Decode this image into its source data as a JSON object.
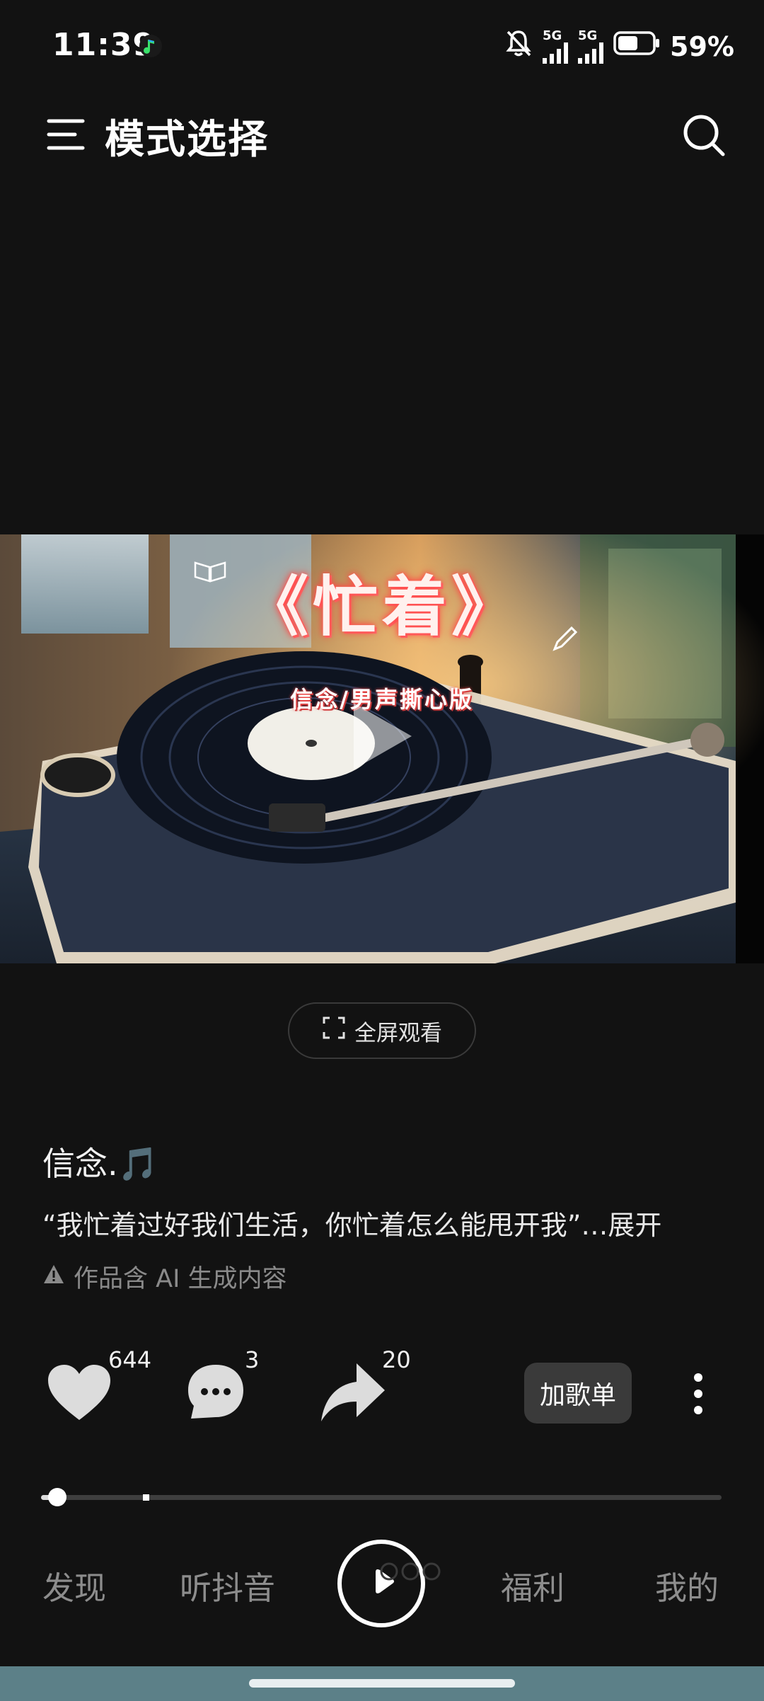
{
  "status_bar": {
    "time": "11:39",
    "signal1_label": "5G",
    "signal2_label": "5G",
    "battery_percent": "59%",
    "battery_level": 0.59
  },
  "header": {
    "title": "模式选择"
  },
  "video": {
    "overlay_title": "《忙着》",
    "overlay_subtitle": "信念/男声撕心版"
  },
  "fullscreen": {
    "label": "全屏观看"
  },
  "song": {
    "title": "信念.🎵",
    "lyric": "“我忙着过好我们生活，你忙着怎么能甩开我”…",
    "expand_label": "展开",
    "ai_notice": "作品含 AI 生成内容"
  },
  "actions": {
    "like_count": "644",
    "comment_count": "3",
    "share_count": "20",
    "add_playlist_label": "加歌单"
  },
  "progress": {
    "fraction": 0.024
  },
  "bottom_nav": {
    "items": [
      "发现",
      "听抖音",
      "福利",
      "我的"
    ]
  },
  "colors": {
    "background": "#121212",
    "title_accent": "#ff6b6b"
  }
}
